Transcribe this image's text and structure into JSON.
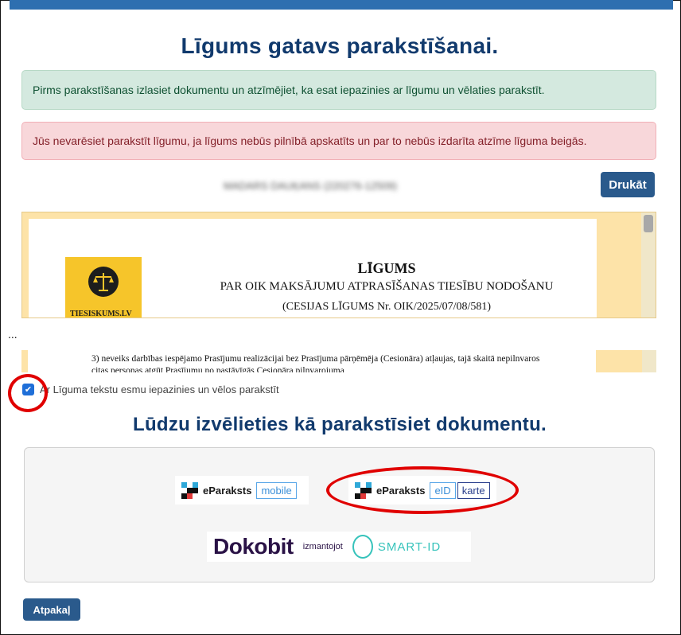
{
  "page": {
    "title": "Līgums gatavs parakstīšanai.",
    "info_alert": "Pirms parakstīšanas izlasiet dokumentu un atzīmējiet, ka esat iepazinies ar līgumu un vēlaties parakstīt.",
    "warning_alert": "Jūs nevarēsiet parakstīt līgumu, ja līgums nebūs pilnībā apskatīts un par to nebūs izdarīta atzīme līguma beigās.",
    "signer_name": "MADARS DAUĶANS (220276-12509)",
    "print_button": "Drukāt",
    "ellipsis": "..."
  },
  "document": {
    "logo_text": "TIESISKUMS.LV",
    "heading": "LĪGUMS",
    "subheading": "PAR OIK MAKSĀJUMU ATPRASĪŠANAS TIESĪBU NODOŠANU",
    "contract_no": "(CESIJAS LĪGUMS Nr. OIK/2025/07/08/581)",
    "excerpt_line1": "3) neveiks darbības iespējamo Prasījumu realizācijai bez Prasījuma pārņēmēja (Cesionāra) atļaujas, tajā skaitā nepilnvaros",
    "excerpt_line2": "citas personas atgūt Prasījumu no pastāvīgās Cesionāra pilnvarojuma"
  },
  "agreement": {
    "checked": true,
    "label": "Ar Līguma tekstu esmu iepazinies un vēlos parakstīt"
  },
  "signing": {
    "heading": "Lūdzu izvēlieties kā parakstīsiet dokumentu.",
    "eparaksts_mobile": {
      "name": "eParaksts",
      "tag": "mobile"
    },
    "eparaksts_card": {
      "name": "eParaksts",
      "tag1": "eID",
      "tag2": "karte"
    },
    "dokobit": {
      "name": "Dokobit",
      "using": "izmantojot",
      "smart_id": "SMART-ID"
    }
  },
  "back_button": "Atpakaļ",
  "colors": {
    "primary": "#113a6d",
    "button": "#2a5a8c",
    "highlight": "#e00000"
  }
}
